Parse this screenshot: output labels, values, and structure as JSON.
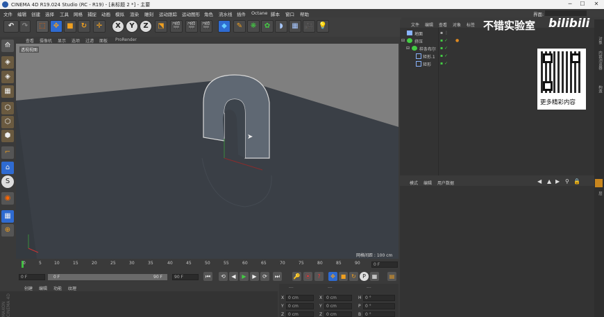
{
  "window": {
    "title": "CINEMA 4D R19.024 Studio (RC - R19) - [未标题 2 *] - 主要",
    "controls": [
      "─",
      "☐",
      "✕"
    ]
  },
  "menubar": [
    "文件",
    "编辑",
    "创建",
    "选择",
    "工具",
    "网格",
    "捕捉",
    "动画",
    "模拟",
    "渲染",
    "雕刻",
    "运动跟踪",
    "运动图形",
    "角色",
    "流水线",
    "插件",
    "Octane",
    "脚本",
    "窗口",
    "帮助"
  ],
  "interface_label": "界面:",
  "toolbar_letters": {
    "x": "X",
    "y": "Y",
    "z": "Z"
  },
  "viewport": {
    "menu": [
      "查看",
      "摄像机",
      "显示",
      "选项",
      "过滤",
      "面板",
      "ProRender"
    ],
    "label": "透视视图",
    "grid_spacing": "网格间距 : 100 cm"
  },
  "objects_panel": {
    "menu": [
      "文件",
      "编辑",
      "查看",
      "对象",
      "标签"
    ],
    "items": [
      {
        "name": "地面",
        "level": 0
      },
      {
        "name": "挤压",
        "level": 0
      },
      {
        "name": "样条布尔",
        "level": 1
      },
      {
        "name": "矩形.1",
        "level": 2
      },
      {
        "name": "矩形",
        "level": 2
      }
    ]
  },
  "watermark": {
    "text": "不错实验室",
    "brand": "bilibili",
    "qr_caption": "更多精彩内容"
  },
  "attributes_panel": {
    "menu": [
      "模式",
      "编辑",
      "用户数据"
    ]
  },
  "timeline": {
    "ticks": [
      "0",
      "5",
      "10",
      "15",
      "20",
      "25",
      "30",
      "35",
      "40",
      "45",
      "50",
      "55",
      "60",
      "65",
      "70",
      "75",
      "80",
      "85",
      "90"
    ],
    "end_frame": "0 F"
  },
  "transport": {
    "current": "0 F",
    "start": "0 F",
    "end": "90 F",
    "end2": "90 F"
  },
  "material_panel": {
    "menu": [
      "创建",
      "编辑",
      "功能",
      "纹理"
    ]
  },
  "coordinates": {
    "headers": [
      "---",
      "---",
      "---"
    ],
    "rows": [
      {
        "a": "X",
        "av": "0 cm",
        "b": "X",
        "bv": "0 cm",
        "c": "H",
        "cv": "0 °"
      },
      {
        "a": "Y",
        "av": "0 cm",
        "b": "Y",
        "bv": "0 cm",
        "c": "P",
        "cv": "0 °"
      },
      {
        "a": "Z",
        "av": "0 cm",
        "b": "Z",
        "bv": "0 cm",
        "c": "B",
        "cv": "0 °"
      }
    ]
  },
  "side_tabs": [
    "对象",
    "内容浏览器",
    "构造",
    "层"
  ],
  "side_brand": "MAXON CINEMA 4D",
  "colors": {
    "accent_blue": "#2f6bd1",
    "ui_dark": "#333333",
    "viewport_floor": "#3a3f46",
    "viewport_sky": "#7d7d7d",
    "object_gray": "#5a6470"
  }
}
